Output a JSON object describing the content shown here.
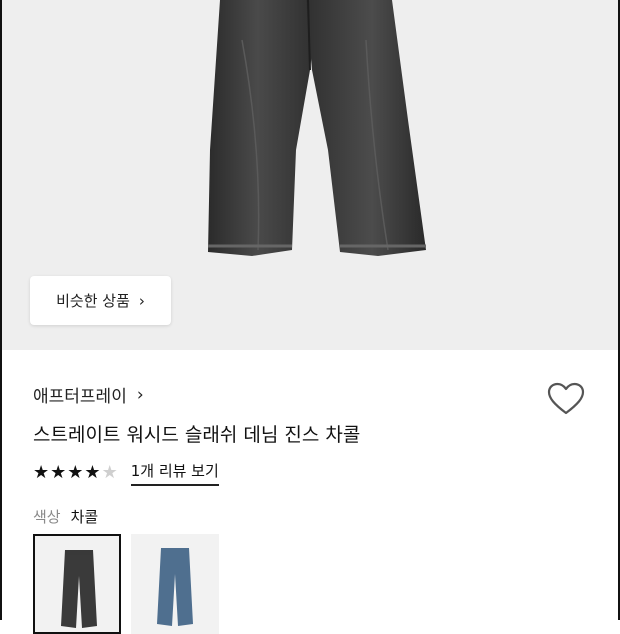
{
  "similar_products": {
    "label": "비슷한 상품",
    "chevron": "›"
  },
  "product": {
    "brand": "애프터프레이",
    "brand_chevron": "›",
    "title": "스트레이트 워시드 슬래쉬 데님 진스 차콜",
    "rating": 4,
    "rating_max": 5,
    "review_link": "1개 리뷰 보기"
  },
  "options": {
    "color_label": "색상",
    "color_selected": "차콜",
    "swatches": [
      {
        "name": "charcoal",
        "color": "#3a3a3a",
        "selected": true
      },
      {
        "name": "blue",
        "color": "#4f6f8f",
        "selected": false
      }
    ]
  },
  "icons": {
    "heart": "heart-outline-icon",
    "chevron": "chevron-right-icon",
    "star": "star-icon"
  },
  "colors": {
    "hero_bg": "#eeeeee",
    "text": "#111111",
    "muted": "#8a8a8a",
    "star_on": "#111111",
    "star_off": "#cfcfcf"
  }
}
